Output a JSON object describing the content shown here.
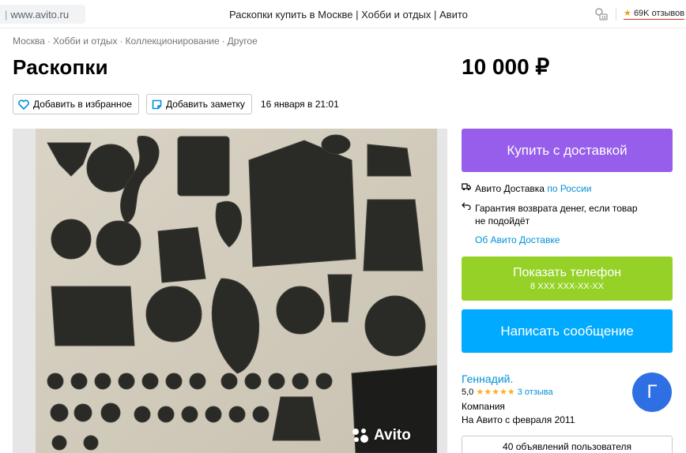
{
  "browser": {
    "url": "www.avito.ru",
    "page_title": "Раскопки купить в Москве | Хобби и отдых | Авито",
    "reviews_badge": "69K отзывов"
  },
  "breadcrumbs": [
    "Москва",
    "Хобби и отдых",
    "Коллекционирование",
    "Другое"
  ],
  "listing": {
    "title": "Раскопки",
    "price": "10 000 ₽",
    "favorite_label": "Добавить в избранное",
    "note_label": "Добавить заметку",
    "date": "16 января в 21:01",
    "watermark": "Avito"
  },
  "delivery": {
    "buy_button": "Купить с доставкой",
    "delivery_text": "Авито Доставка",
    "delivery_link": "по России",
    "guarantee_text": "Гарантия возврата денег, если товар не подойдёт",
    "about_link": "Об Авито Доставке"
  },
  "contact": {
    "show_phone": "Показать телефон",
    "phone_masked": "8 XXX XXX-XX-XX",
    "write_message": "Написать сообщение"
  },
  "seller": {
    "name": "Геннадий.",
    "rating": "5,0",
    "stars": "★★★★★",
    "reviews_link": "3 отзыва",
    "type": "Компания",
    "since": "На Авито с февраля 2011",
    "avatar_letter": "Г",
    "ads_button": "40 объявлений пользователя"
  },
  "colors": {
    "purple": "#965eeb",
    "green": "#96d128",
    "blue": "#00aaff",
    "link": "#0091d9",
    "avatar": "#2f6fe4",
    "star": "#ffb021"
  }
}
